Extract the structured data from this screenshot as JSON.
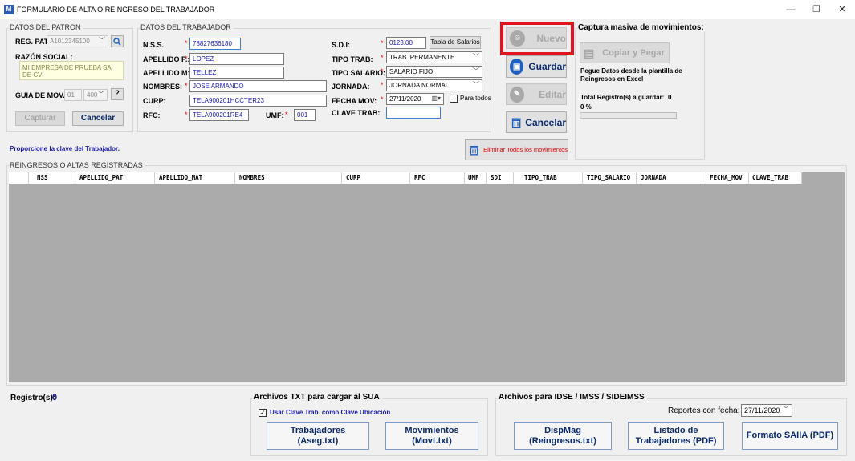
{
  "window": {
    "icon_letter": "M",
    "title": "FORMULARIO DE ALTA O REINGRESO DEL TRABAJADOR",
    "minimize": "—",
    "restore": "❐",
    "close": "✕"
  },
  "patron": {
    "group_title": "DATOS DEL PATRON",
    "reg_pat_label": "REG. PAT.",
    "reg_pat_value": "A1012345100",
    "razon_social_label": "RAZÓN SOCIAL:",
    "razon_social_value": "MI EMPRESA DE PRUEBA SA DE CV",
    "guia_label": "GUIA DE MOV.",
    "guia_value1": "01",
    "guia_value2": "400",
    "help_label": "?",
    "capturar_label": "Capturar",
    "cancelar_label": "Cancelar"
  },
  "trabajador": {
    "group_title": "DATOS DEL TRABAJADOR",
    "nss_label": "N.S.S.",
    "nss_value": "78827636180",
    "apellido_p_label": "APELLIDO P.:",
    "apellido_p_value": "LOPEZ",
    "apellido_m_label": "APELLIDO M:",
    "apellido_m_value": "TELLEZ",
    "nombres_label": "NOMBRES:",
    "nombres_value": "JOSE ARMANDO",
    "curp_label": "CURP:",
    "curp_value": "TELA900201HCCTER23",
    "rfc_label": "RFC:",
    "rfc_value": "TELA900201RE4",
    "umf_label": "UMF:",
    "umf_value": "001",
    "sdi_label": "S.D.I:",
    "sdi_value": "0123.00",
    "tabla_salarios_label": "Tabla de Salarios",
    "tipo_trab_label": "TIPO TRAB:",
    "tipo_trab_value": "TRAB. PERMANENTE",
    "tipo_salario_label": "TIPO SALARIO:",
    "tipo_salario_value": "SALARIO FIJO",
    "jornada_label": "JORNADA:",
    "jornada_value": "JORNADA NORMAL",
    "fecha_mov_label": "FECHA MOV:",
    "fecha_mov_value": "27/11/2020",
    "para_todos_label": "Para todos",
    "clave_trab_label": "CLAVE TRAB:",
    "clave_trab_value": ""
  },
  "actions": {
    "nuevo_label": "Nuevo",
    "guardar_label": "Guardar",
    "editar_label": "Editar",
    "cancelar_label": "Cancelar",
    "eliminar_todos_label": "Eliminar Todos los movimientos"
  },
  "masiva": {
    "title": "Captura masiva de movimientos:",
    "copiar_pegar_label": "Copiar y Pegar",
    "hint": "Pegue Datos desde la plantilla de Reingresos en Excel",
    "total_label": "Total Registro(s) a guardar:",
    "total_value": "0",
    "progress_text": "0 %",
    "progress": 0
  },
  "prompt_text": "Proporcione la clave del Trabajador.",
  "grid": {
    "group_title": "REINGRESOS O ALTAS REGISTRADAS",
    "columns": [
      "NSS",
      "APELLIDO_PAT",
      "APELLIDO_MAT",
      "NOMBRES",
      "CURP",
      "RFC",
      "UMF",
      "SDI",
      "TIPO_TRAB",
      "TIPO_SALARIO",
      "JORNADA",
      "FECHA_MOV",
      "CLAVE_TRAB"
    ]
  },
  "footer": {
    "registros_label": "Registro(s):",
    "registros_value": "0",
    "sua_title": "Archivos  TXT para cargar al SUA",
    "usar_clave_label": "Usar Clave Trab. como Clave Ubicación",
    "trabajadores_btn": [
      "Trabajadores",
      "(Aseg.txt)"
    ],
    "movimientos_btn": [
      "Movimientos",
      "(Movt.txt)"
    ],
    "idse_title": "Archivos para IDSE / IMSS / SIDEIMSS",
    "reportes_label": "Reportes con fecha:",
    "reportes_value": "27/11/2020",
    "dispmag_btn": [
      "DispMag",
      "(Reingresos.txt)"
    ],
    "listado_btn": [
      "Listado de",
      "Trabajadores (PDF)"
    ],
    "saiia_btn": "Formato SAIIA (PDF)"
  },
  "colors": {
    "highlight_border": "#e0141e",
    "accent_blue": "#1a1ab0"
  }
}
